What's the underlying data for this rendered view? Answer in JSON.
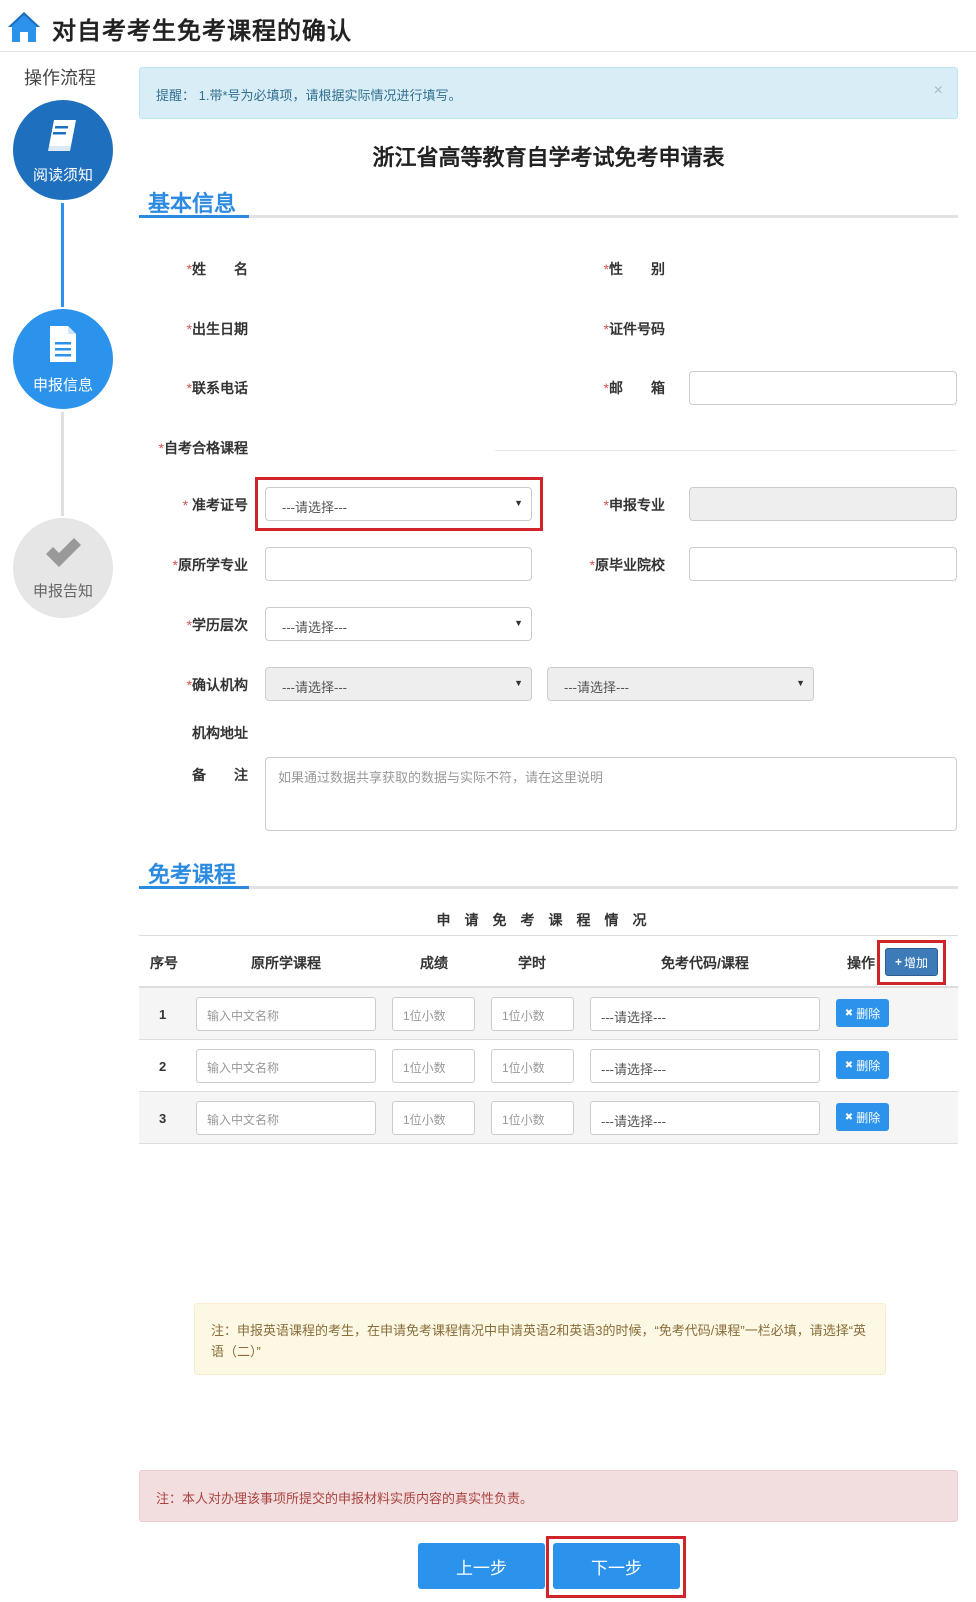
{
  "header": {
    "title": "对自考考生免考课程的确认"
  },
  "sidebar": {
    "title": "操作流程",
    "steps": [
      {
        "label": "阅读须知",
        "state": "done"
      },
      {
        "label": "申报信息",
        "state": "current"
      },
      {
        "label": "申报告知",
        "state": "pending"
      }
    ]
  },
  "alert_info": {
    "text": "提醒： 1.带*号为必填项，请根据实际情况进行填写。",
    "close": "×"
  },
  "form_title": "浙江省高等教育自学考试免考申请表",
  "basic": {
    "section_title": "基本信息",
    "req_mark": "*",
    "name_label": "姓　　名",
    "gender_label": "性　　别",
    "birth_label": "出生日期",
    "id_label": "证件号码",
    "phone_label": "联系电话",
    "email_label": "邮　　箱",
    "passed_courses_label": "自考合格课程",
    "ticket_label": " 准考证号",
    "ticket_value": "---请选择---",
    "major_label": "申报专业",
    "orig_major_label": "原所学专业",
    "orig_school_label": "原毕业院校",
    "edu_level_label": "学历层次",
    "edu_level_value": "---请选择---",
    "confirm_org_label": "确认机构",
    "confirm_org_value1": "---请选择---",
    "confirm_org_value2": "---请选择---",
    "org_address_label": "机构地址",
    "remark_label": "备　　注",
    "remark_placeholder": "如果通过数据共享获取的数据与实际不符，请在这里说明"
  },
  "exempt": {
    "section_title": "免考课程",
    "caption": "申请免考课程情况",
    "headers": {
      "num": "序号",
      "course": "原所学课程",
      "score": "成绩",
      "hours": "学时",
      "code": "免考代码/课程",
      "op": "操作"
    },
    "add_button": "增加",
    "add_icon": "+",
    "delete_button": "删除",
    "delete_icon": "✖",
    "rows": [
      {
        "num": "1",
        "course_ph": "输入中文名称",
        "score_ph": "1位小数",
        "hours_ph": "1位小数",
        "code_value": "---请选择---"
      },
      {
        "num": "2",
        "course_ph": "输入中文名称",
        "score_ph": "1位小数",
        "hours_ph": "1位小数",
        "code_value": "---请选择---"
      },
      {
        "num": "3",
        "course_ph": "输入中文名称",
        "score_ph": "1位小数",
        "hours_ph": "1位小数",
        "code_value": "---请选择---"
      }
    ]
  },
  "note_warning": "注：申报英语课程的考生，在申请免考课程情况中申请英语2和英语3的时候，“免考代码/课程”一栏必填，请选择“英语（二）”",
  "note_danger": "注：本人对办理该事项所提交的申报材料实质内容的真实性负责。",
  "nav": {
    "prev": "上一步",
    "next": "下一步"
  },
  "colors": {
    "primary": "#2c93ec",
    "dark_primary": "#1e6fbd",
    "highlight": "#d0242b"
  }
}
